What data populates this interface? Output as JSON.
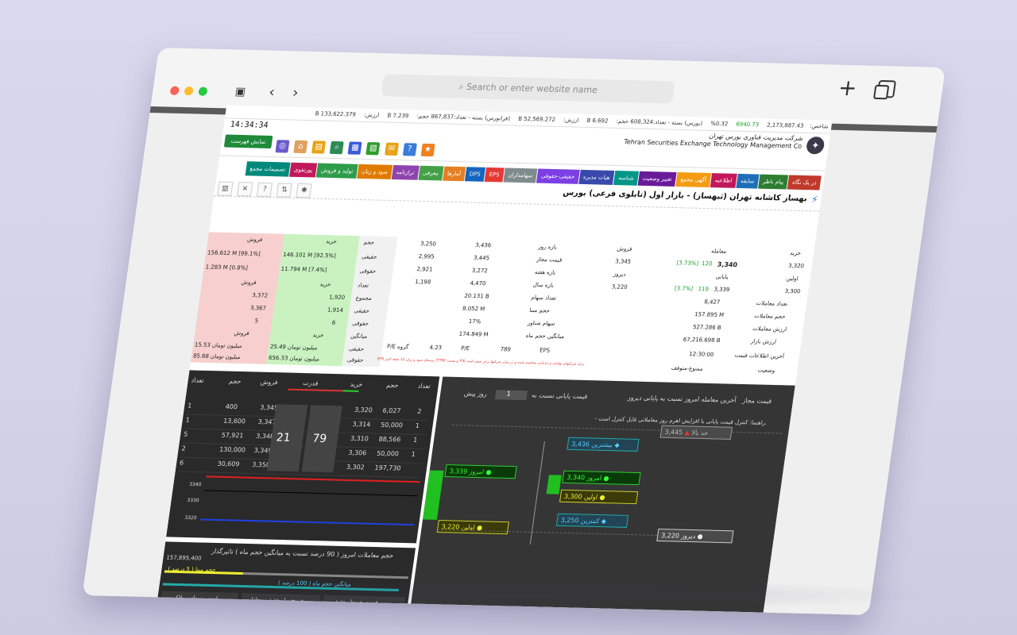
{
  "browser": {
    "url_placeholder": "Search or enter website name"
  },
  "ticker": {
    "index_label": "شاخص:",
    "index_value": "2,173,887.43",
    "index_change": "6940.73",
    "index_pct": "0.32%",
    "volume_text": "(بورس) بسته - تعداد:608,324 حجم:",
    "volume_b": "6.692 B",
    "value_label": "ارزش:",
    "value_b": "52,569.272 B",
    "otc_text": "(فرابورس) بسته - تعداد:867,837 حجم:",
    "otc_b": "7.239 B",
    "otc_value_label": "ارزش:",
    "otc_value": "133,622.379 B"
  },
  "header": {
    "org_fa": "شرکت مدیریت فناوری بورس تهران",
    "org_en": "Tehran Securities Exchange Technology Management Co",
    "clock": "14:34:34",
    "show_list": "نمایش فهرست"
  },
  "nav": {
    "items": [
      {
        "label": "در یک نگاه",
        "color": "#c0392b"
      },
      {
        "label": "پیام ناظر",
        "color": "#2e7d32"
      },
      {
        "label": "سابقه",
        "color": "#1e6fb8"
      },
      {
        "label": "اطلاعیه",
        "color": "#c2185b"
      },
      {
        "label": "آگهی مجمع",
        "color": "#f39c12"
      },
      {
        "label": "تغییر وضعیت",
        "color": "#6a1b9a"
      },
      {
        "label": "شناسه",
        "color": "#009688"
      },
      {
        "label": "هیات مدیره",
        "color": "#3949ab"
      },
      {
        "label": "حقیقی-حقوقی",
        "color": "#7b3fe4"
      },
      {
        "label": "سهامداران",
        "color": "#7f8c8d"
      },
      {
        "label": "EPS",
        "color": "#e53935"
      },
      {
        "label": "DPS",
        "color": "#1565c0"
      },
      {
        "label": "آمارها",
        "color": "#e67e22"
      },
      {
        "label": "معرفی",
        "color": "#43a047"
      },
      {
        "label": "ترازنامه",
        "color": "#8e44ad"
      },
      {
        "label": "سود و زیان",
        "color": "#e07b00"
      },
      {
        "label": "تولید و فروش",
        "color": "#2e9c4a"
      },
      {
        "label": "پورتفوی",
        "color": "#c2185b"
      },
      {
        "label": "تصمیمات مجمع",
        "color": "#00897b"
      }
    ]
  },
  "title": "بهساز کاشانه تهران (ثبهساز) - بازار اول (تابلوی فرعی) بورس",
  "info": {
    "trade_label": "معامله",
    "sell_label": "فروش",
    "buy_label": "خرید",
    "last_price": "3,340",
    "last_change": "120",
    "last_pct": "[3.73%]",
    "buy1": "3,320",
    "sell1": "3,345",
    "close_label": "پایانی",
    "close_price": "3,339",
    "close_change": "119",
    "close_pct": "[3.7%]",
    "yesterday_label": "دیروز",
    "yesterday": "3,220",
    "first_label": "اولین",
    "first": "3,300",
    "count_label": "تعداد معاملات",
    "count": "8,427",
    "volume_label": "حجم معاملات",
    "volume": "157.895 M",
    "value_label": "ارزش معاملات",
    "value": "527.286 B",
    "mcap_label": "ارزش بازار",
    "mcap": "67,216.698 B",
    "lastinfo_label": "آخرین اطلاعات قیمت",
    "lastinfo": "12:30:00",
    "status_label": "وضعیت",
    "status": "ممنوع-متوقف",
    "day_range_label": "بازه روز",
    "day_low": "3,250",
    "day_high": "3,436",
    "allowed_label": "قیمت مجاز",
    "allowed_low": "2,995",
    "allowed_high": "3,445",
    "week_label": "بازه هفته",
    "week_low": "2,921",
    "week_high": "3,272",
    "year_label": "بازه سال",
    "year_low": "1,198",
    "year_high": "4,470",
    "shares_label": "تعداد سهام",
    "shares": "20.131 B",
    "base_label": "حجم مبنا",
    "base": "8.052 M",
    "float_label": "سهام شناور",
    "float": "17%",
    "avgvol_label": "میانگین حجم ماه",
    "avgvol": "174.849 M",
    "eps_label": "EPS",
    "eps": "789",
    "pe_label": "P/E",
    "pe": "4.23",
    "gpe_label": "P/E گروه",
    "gpe": "",
    "note": "EPS برمبنای سود و زیان 12 ماهه اخیر (TTM) و نسبت P/E برای شرکتهای تولیدی و خدماتی محاسبه شده و در سایر شرکتها برابر صفر است."
  },
  "pk": {
    "h_buy": "خرید",
    "h_sell": "فروش",
    "l_volume": "حجم",
    "l_real": "حقیقی",
    "real_buy": "146.101 M [92.5%]",
    "real_sell": "156.612 M [99.1%]",
    "l_legal": "حقوقی",
    "legal_buy": "11.794 M [7.4%]",
    "legal_sell": "1.283 M [0.8%]",
    "l_count": "تعداد",
    "c_buy_h": "خرید",
    "c_sell_h": "فروش",
    "l_total": "مجموع",
    "total_buy": "1,920",
    "total_sell": "3,372",
    "real_cbuy": "1,914",
    "real_csell": "3,367",
    "legal_cbuy": "6",
    "legal_csell": "5",
    "l_avg": "میانگین",
    "avg_buy_h": "خرید",
    "avg_sell_h": "فروش",
    "avg_real_buy": "25.49 میلیون تومان",
    "avg_real_sell": "15.53 میلیون تومان",
    "avg_legal_buy": "656.33 میلیون تومان",
    "avg_legal_sell": "85.68 میلیون تومان"
  },
  "orderbook": {
    "h_count": "تعداد",
    "h_vol": "حجم",
    "h_buy": "خرید",
    "h_power": "قدرت",
    "h_sell": "فروش",
    "rows": [
      {
        "bc": "2",
        "bv": "6,027",
        "bp": "3,320",
        "sp": "3,345",
        "sv": "400",
        "sc": "1"
      },
      {
        "bc": "1",
        "bv": "50,000",
        "bp": "3,314",
        "sp": "3,347",
        "sv": "13,600",
        "sc": "1"
      },
      {
        "bc": "1",
        "bv": "88,566",
        "bp": "3,310",
        "sp": "3,348",
        "sv": "57,921",
        "sc": "5"
      },
      {
        "bc": "1",
        "bv": "50,000",
        "bp": "3,306",
        "sp": "3,349",
        "sv": "130,000",
        "sc": "2"
      },
      {
        "bc": "",
        "bv": "197,730",
        "bp": "3,302",
        "sp": "3,350",
        "sv": "30,609",
        "sc": "6"
      }
    ],
    "power_buy": "79",
    "power_sell": "21",
    "y_ticks": [
      "3340",
      "3330",
      "3320"
    ]
  },
  "priceladder": {
    "h_allowed": "قیمت مجاز",
    "h_last": "آخرین معامله امروز نسبت به پایانی دیروز",
    "h_close": "قیمت پایانی نسبت به",
    "h_close2": "روز پیش",
    "days": "1",
    "hint": "- راهنما: کنترل قیمت پایانی با افزایش اهرم روز معاملاتی قابل کنترل است.",
    "upper": "3,445",
    "upper_label": "حد بالا",
    "max": "3,436",
    "max_label": "بیشترین",
    "today": "3,340",
    "today_label": "امروز",
    "first": "3,300",
    "first_label": "اولین",
    "min": "3,250",
    "min_label": "کمترین",
    "yest": "3,220",
    "yest_label": "دیروز",
    "close": "3,339",
    "close_label": "امروز",
    "open": "3,220",
    "open_label": "اولین"
  },
  "volbar": {
    "title": "حجم معاملات امروز ( 90 درصد نسبت به میانگین حجم ماه ) تاثیرگذار",
    "total": "157,895,400",
    "base_label": "حجم مبنا ( 5 درصد )",
    "avg_label": "میانگین حجم ماه ( 100 درصد )",
    "btn1": "قدرت خریدار حقیقی",
    "btn2": "خروج پول حقیقی معادل",
    "btn3": "از دست دادن مالکیت"
  }
}
